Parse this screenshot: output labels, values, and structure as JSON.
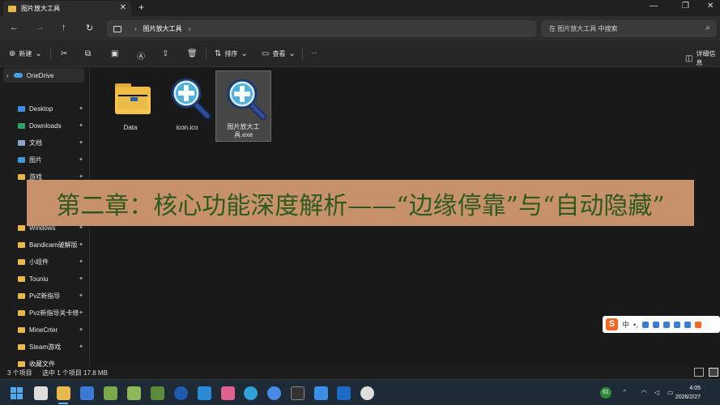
{
  "window": {
    "tab_title": "图片放大工具",
    "close_tab": "✕",
    "new_tab": "+",
    "minimize": "—",
    "maximize": "❐",
    "close": "✕"
  },
  "nav": {
    "back": "←",
    "forward": "→",
    "up": "↑",
    "refresh": "↻"
  },
  "address": {
    "crumb": "图片放大工具",
    "sep1": "›",
    "sep2": "›"
  },
  "search": {
    "placeholder": "在 图片放大工具 中搜索",
    "icon": "⌕"
  },
  "toolbar": {
    "new_label": "新建",
    "sort_label": "排序",
    "view_label": "查看",
    "more_label": "···",
    "details_label": "详细信息"
  },
  "sidebar": {
    "onedrive": "OneDrive",
    "items": [
      {
        "label": "Desktop",
        "icon": "desktop-icon",
        "color": "#3a8ee6"
      },
      {
        "label": "Downloads",
        "icon": "download-icon",
        "color": "#2fa46a"
      },
      {
        "label": "文档",
        "icon": "document-icon",
        "color": "#8ca4c8"
      },
      {
        "label": "图片",
        "icon": "pictures-icon",
        "color": "#3c9ad6"
      },
      {
        "label": "游戏",
        "icon": "folder-icon",
        "color": "#e8b84a"
      },
      {
        "label": "Windows",
        "icon": "folder-icon",
        "color": "#e8b84a"
      },
      {
        "label": "Bandicam破解版",
        "icon": "folder-icon",
        "color": "#e8b84a"
      },
      {
        "label": "小组件",
        "icon": "folder-icon",
        "color": "#e8b84a"
      },
      {
        "label": "Touniu",
        "icon": "folder-icon",
        "color": "#e8b84a"
      },
      {
        "label": "PvZ新指导",
        "icon": "folder-icon",
        "color": "#e8b84a"
      },
      {
        "label": "Pvz新指导关卡修",
        "icon": "folder-icon",
        "color": "#e8b84a"
      },
      {
        "label": "MineCrter",
        "icon": "folder-icon",
        "color": "#e8b84a"
      },
      {
        "label": "Steam游戏",
        "icon": "folder-icon",
        "color": "#e8b84a"
      },
      {
        "label": "收藏文件",
        "icon": "folder-icon",
        "color": "#e8b84a"
      }
    ],
    "pin": "📌"
  },
  "files": [
    {
      "name": "Data",
      "type": "folder"
    },
    {
      "name": "icon.ico",
      "type": "icon"
    },
    {
      "name": "图片放大工具.exe",
      "type": "exe"
    }
  ],
  "banner": {
    "text": "第二章：核心功能深度解析——“边缘停靠”与“自动隐藏”"
  },
  "status": {
    "count": "3 个项目",
    "selected": "选中 1 个项目  17.8 MB"
  },
  "ime": {
    "logo": "S",
    "mode": "中",
    "punct": "•,"
  },
  "clock": {
    "time": "4:05",
    "date": "2026/2/27"
  },
  "tray": {
    "badge": "61"
  }
}
